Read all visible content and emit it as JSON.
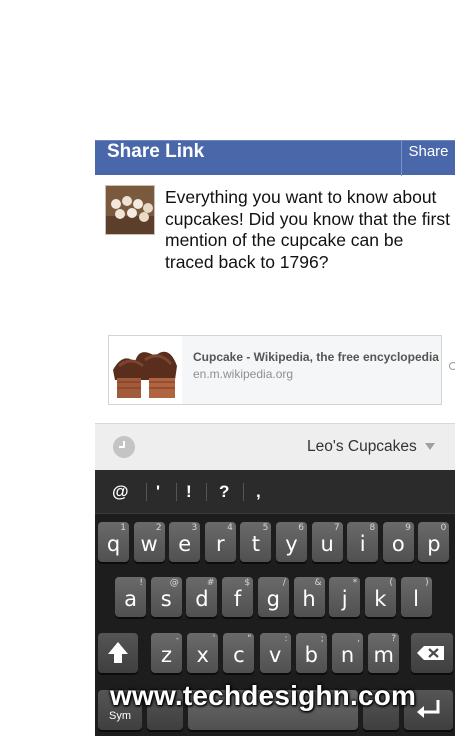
{
  "header": {
    "title": "Share Link",
    "share_label": "Share"
  },
  "post": {
    "thumbnail_icon": "cupcakes-photo",
    "text": "Everything you want to know about cupcakes! Did you know that the first mention of the cupcake can be traced back to 1796?"
  },
  "link_card": {
    "image_icon": "chocolate-cupcakes-photo",
    "title": "Cupcake - Wikipedia, the free encyclopedia",
    "url": "en.m.wikipedia.org"
  },
  "privacy": {
    "icon": "clock-icon",
    "page_name": "Leo's Cupcakes"
  },
  "keyboard": {
    "suggestions": [
      "@",
      "'",
      "!",
      "?",
      ","
    ],
    "row1": [
      {
        "k": "q",
        "a": "1"
      },
      {
        "k": "w",
        "a": "2"
      },
      {
        "k": "e",
        "a": "3"
      },
      {
        "k": "r",
        "a": "4"
      },
      {
        "k": "t",
        "a": "5"
      },
      {
        "k": "y",
        "a": "6"
      },
      {
        "k": "u",
        "a": "7"
      },
      {
        "k": "i",
        "a": "8"
      },
      {
        "k": "o",
        "a": "9"
      },
      {
        "k": "p",
        "a": "0"
      }
    ],
    "row2": [
      {
        "k": "a",
        "a": "!"
      },
      {
        "k": "s",
        "a": "@"
      },
      {
        "k": "d",
        "a": "#"
      },
      {
        "k": "f",
        "a": "$"
      },
      {
        "k": "g",
        "a": "/"
      },
      {
        "k": "h",
        "a": "&"
      },
      {
        "k": "j",
        "a": "*"
      },
      {
        "k": "k",
        "a": "("
      },
      {
        "k": "l",
        "a": ")"
      }
    ],
    "row3": [
      {
        "k": "z",
        "a": "-"
      },
      {
        "k": "x",
        "a": "'"
      },
      {
        "k": "c",
        "a": "\""
      },
      {
        "k": "v",
        "a": ":"
      },
      {
        "k": "b",
        "a": ";"
      },
      {
        "k": "n",
        "a": ","
      },
      {
        "k": "m",
        "a": "?"
      }
    ],
    "shift_icon": "shift-arrow-icon",
    "backspace_icon": "backspace-icon",
    "sym_label": "Sym",
    "enter_icon": "enter-icon"
  },
  "watermark": "www.techdesighn.com"
}
